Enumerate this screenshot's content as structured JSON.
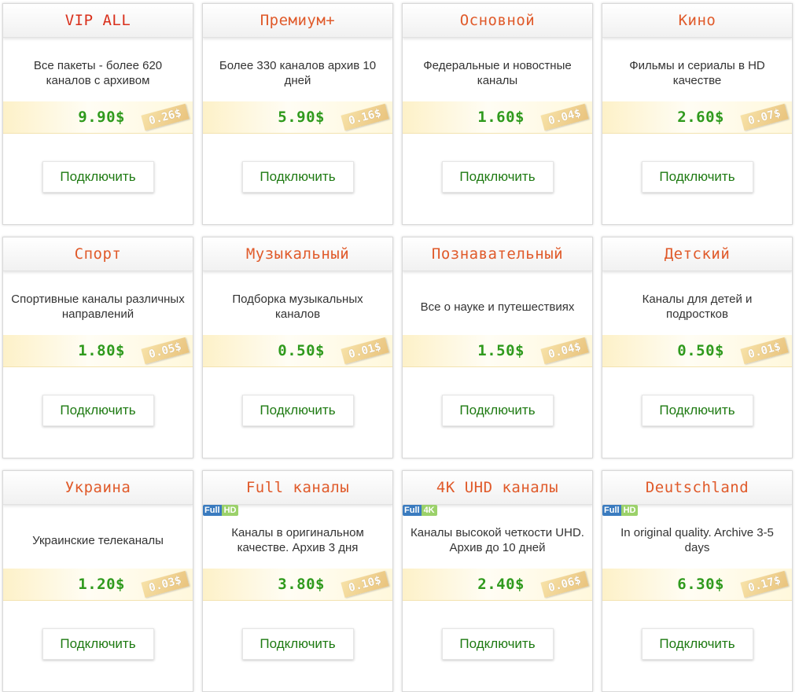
{
  "cards": [
    {
      "title": "VIP ALL",
      "desc": "Все пакеты - более 620 каналов с архивом",
      "price": "9.90$",
      "per_day": "0.26$",
      "button": "Подключить"
    },
    {
      "title": "Премиум+",
      "desc": "Более 330 каналов архив 10 дней",
      "price": "5.90$",
      "per_day": "0.16$",
      "button": "Подключить"
    },
    {
      "title": "Основной",
      "desc": "Федеральные и новостные каналы",
      "price": "1.60$",
      "per_day": "0.04$",
      "button": "Подключить"
    },
    {
      "title": "Кино",
      "desc": "Фильмы и сериалы в HD качестве",
      "price": "2.60$",
      "per_day": "0.07$",
      "button": "Подключить"
    },
    {
      "title": "Спорт",
      "desc": "Спортивные каналы различных направлений",
      "price": "1.80$",
      "per_day": "0.05$",
      "button": "Подключить"
    },
    {
      "title": "Музыкальный",
      "desc": "Подборка музыкальных каналов",
      "price": "0.50$",
      "per_day": "0.01$",
      "button": "Подключить"
    },
    {
      "title": "Познавательный",
      "desc": "Все о науке и путешествиях",
      "price": "1.50$",
      "per_day": "0.04$",
      "button": "Подключить"
    },
    {
      "title": "Детский",
      "desc": "Каналы для детей и подростков",
      "price": "0.50$",
      "per_day": "0.01$",
      "button": "Подключить"
    },
    {
      "title": "Украина",
      "desc": "Украинские телеканалы",
      "price": "1.20$",
      "per_day": "0.03$",
      "button": "Подключить"
    },
    {
      "title": "Full каналы",
      "desc": "Каналы в оригинальном качестве. Архив 3 дня",
      "price": "3.80$",
      "per_day": "0.10$",
      "button": "Подключить",
      "badge": [
        "Full",
        "HD"
      ]
    },
    {
      "title": "4K UHD каналы",
      "desc": "Каналы высокой четкости UHD. Архив до 10 дней",
      "price": "2.40$",
      "per_day": "0.06$",
      "button": "Подключить",
      "badge": [
        "Full",
        "4K"
      ]
    },
    {
      "title": "Deutschland",
      "desc": "In original quality. Archive 3-5 days",
      "price": "6.30$",
      "per_day": "0.17$",
      "button": "Подключить",
      "badge": [
        "Full",
        "HD"
      ]
    }
  ]
}
